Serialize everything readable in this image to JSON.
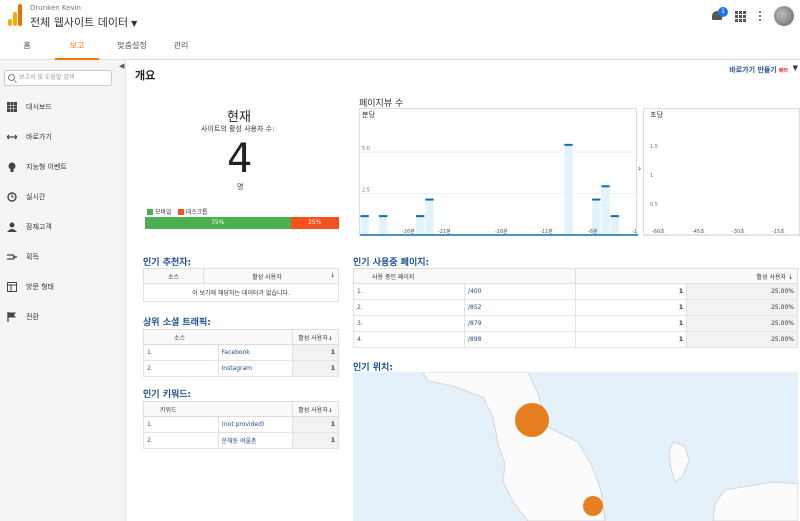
{
  "header": {
    "account": "Drunken Kevin",
    "property": "전체 웹사이트 데이터",
    "notification_count": "1"
  },
  "tabs": [
    {
      "label": "홈"
    },
    {
      "label": "보고"
    },
    {
      "label": "맞춤설정"
    },
    {
      "label": "관리"
    }
  ],
  "sidebar": {
    "search_placeholder": "보고서 및 도움말 검색",
    "items": [
      {
        "label": "대시보드",
        "icon": "dashboard-icon"
      },
      {
        "label": "바로가기",
        "icon": "shortcut-arrows-icon"
      },
      {
        "label": "지능형 이벤트",
        "icon": "lightbulb-icon"
      },
      {
        "label": "실시간",
        "icon": "realtime-clock-icon"
      },
      {
        "label": "잠재고객",
        "icon": "person-icon"
      },
      {
        "label": "획득",
        "icon": "acquisition-icon"
      },
      {
        "label": "방문 형태",
        "icon": "behavior-layout-icon"
      },
      {
        "label": "전환",
        "icon": "flag-icon"
      }
    ]
  },
  "main": {
    "title": "개요",
    "shortcut_label": "바로가기 만들기",
    "shortcut_badge": "베타",
    "now": {
      "label": "현재",
      "subtitle": "사이트의 활성 사용자 수:",
      "count": "4",
      "unit": "명",
      "legend_mobile": "모바일",
      "legend_desktop": "데스크톱",
      "mobile_pct": "75%",
      "desktop_pct": "25%",
      "mobile_share": 0.75,
      "mobile_color": "#4caf50",
      "desktop_color": "#f4511e"
    },
    "pageviews_title": "페이지뷰 수",
    "referrals": {
      "title": "인기 추천자:",
      "col_source": "소스",
      "col_active": "활성 사용자",
      "empty_message": "이 보기에 해당하는 데이터가 없습니다."
    },
    "social": {
      "title": "상위 소셜 트래픽:",
      "col_source": "소스",
      "col_active": "활성 사용자",
      "rows": [
        {
          "idx": "1.",
          "name": "Facebook",
          "count": "1"
        },
        {
          "idx": "2.",
          "name": "Instagram",
          "count": "1"
        }
      ]
    },
    "keywords": {
      "title": "인기 키워드:",
      "col_keyword": "키워드",
      "col_active": "활성 사용자",
      "rows": [
        {
          "idx": "1.",
          "name": "(not provided)",
          "count": "1"
        },
        {
          "idx": "2.",
          "name": "운해동 여울촌",
          "count": "1"
        }
      ]
    },
    "pages": {
      "title": "인기 사용중 페이지:",
      "col_page": "사용 중인 페이지",
      "col_active": "활성 사용자",
      "rows": [
        {
          "idx": "1.",
          "path": "/400",
          "count": "1",
          "pct": "25.00%"
        },
        {
          "idx": "2.",
          "path": "/852",
          "count": "1",
          "pct": "25.00%"
        },
        {
          "idx": "3.",
          "path": "/879",
          "count": "1",
          "pct": "25.00%"
        },
        {
          "idx": "4.",
          "path": "/898",
          "count": "1",
          "pct": "25.00%"
        }
      ]
    },
    "locations_title": "인기 위치:"
  },
  "chart_data": [
    {
      "type": "bar",
      "title": "페이지뷰 수",
      "ylabel": "분당",
      "ylim": [
        0,
        7
      ],
      "yticks": [
        "2.5",
        "5.0"
      ],
      "xticks": [
        "-26분",
        "-21분",
        "-16분",
        "-11분",
        "-6분",
        "-1"
      ],
      "values": [
        1.2,
        0,
        1.2,
        0,
        0,
        0,
        1.2,
        2.2,
        0,
        0,
        0,
        0,
        0,
        0,
        0,
        0,
        0,
        0,
        0,
        0,
        0,
        0,
        5.5,
        0,
        0,
        2.2,
        3,
        1.2,
        0,
        0
      ],
      "colors": {
        "bar_fill": "#e1f3fc",
        "bar_top": "#0e6eb5",
        "baseline": "#0e6eb5"
      }
    },
    {
      "type": "bar",
      "ylabel": "초당",
      "ylim": [
        0,
        2
      ],
      "yticks": [
        "0.5",
        "1",
        "1.5"
      ],
      "xticks": [
        "-60초",
        "-45초",
        "-30초",
        "-15초"
      ],
      "values": []
    }
  ]
}
